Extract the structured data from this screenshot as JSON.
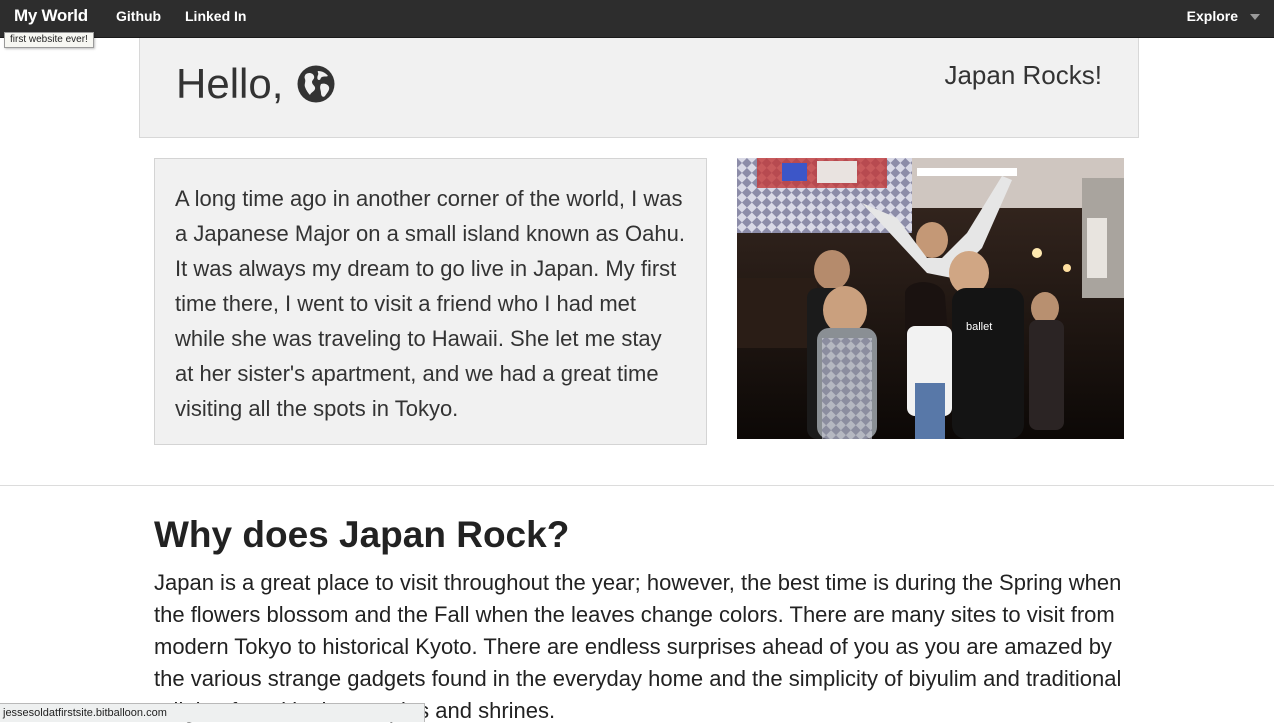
{
  "navbar": {
    "brand": "My World",
    "links": [
      "Github",
      "Linked In"
    ],
    "explore_label": "Explore",
    "tooltip": "first website ever!"
  },
  "jumbotron": {
    "heading": "Hello,",
    "heading_icon": "globe-icon",
    "tagline": "Japan Rocks!"
  },
  "story": {
    "text": "A long time ago in another corner of the world, I was a Japanese Major on a small island known as Oahu. It was always my dream to go live in Japan. My first time there, I went to visit a friend who I had met while she was traveling to Hawaii. She let me stay at her sister's apartment, and we had a great time visiting all the spots in Tokyo."
  },
  "photo": {
    "shirt_text": "ballet"
  },
  "why": {
    "title": "Why does Japan Rock?",
    "body": "Japan is a great place to visit throughout the year; however, the best time is during the Spring when the flowers blossom and the Fall when the leaves change colors. There are many sites to visit from modern Tokyo to historical Kyoto. There are endless surprises ahead of you as you are amazed by the various strange gadgets found in the everyday home and the simplicity of biyulim and traditional religion found in the temples and shrines."
  },
  "status_bar": {
    "url": "jessesoldatfirstsite.bitballoon.com"
  },
  "colors": {
    "navbar_bg": "#2d2d2d",
    "panel_bg": "#f1f1f1"
  }
}
